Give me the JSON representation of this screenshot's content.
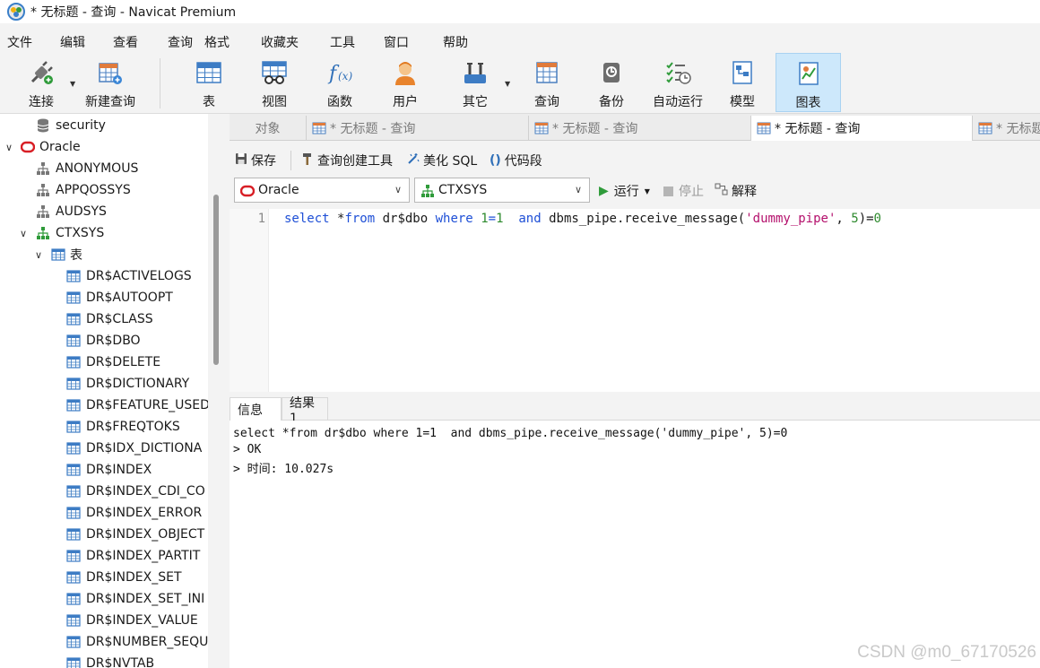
{
  "window": {
    "title": "* 无标题 - 查询 - Navicat Premium"
  },
  "menu": [
    "文件",
    "编辑",
    "查看",
    "查询",
    "格式",
    "收藏夹",
    "工具",
    "窗口",
    "帮助"
  ],
  "toolbar": {
    "connect": "连接",
    "new_query": "新建查询",
    "table": "表",
    "view": "视图",
    "function": "函数",
    "user": "用户",
    "other": "其它",
    "query": "查询",
    "backup": "备份",
    "auto_run": "自动运行",
    "model": "模型",
    "chart": "图表"
  },
  "sidebar": {
    "items": [
      {
        "label": "security",
        "icon": "database-icon"
      },
      {
        "label": "Oracle",
        "icon": "oracle-connection-icon"
      },
      {
        "label": "ANONYMOUS",
        "icon": "schema-icon"
      },
      {
        "label": "APPQOSSYS",
        "icon": "schema-icon"
      },
      {
        "label": "AUDSYS",
        "icon": "schema-icon"
      },
      {
        "label": "CTXSYS",
        "icon": "schema-icon"
      },
      {
        "label": "表",
        "icon": "table-icon"
      }
    ],
    "tables": [
      "DR$ACTIVELOGS",
      "DR$AUTOOPT",
      "DR$CLASS",
      "DR$DBO",
      "DR$DELETE",
      "DR$DICTIONARY",
      "DR$FEATURE_USED",
      "DR$FREQTOKS",
      "DR$IDX_DICTIONA",
      "DR$INDEX",
      "DR$INDEX_CDI_CO",
      "DR$INDEX_ERROR",
      "DR$INDEX_OBJECT",
      "DR$INDEX_PARTIT",
      "DR$INDEX_SET",
      "DR$INDEX_SET_INI",
      "DR$INDEX_VALUE",
      "DR$NUMBER_SEQU",
      "DR$NVTAB"
    ]
  },
  "tabs": [
    "对象",
    "* 无标题 - 查询",
    "* 无标题 - 查询",
    "* 无标题 - 查询",
    "* 无标题"
  ],
  "query_toolbar": {
    "save": "保存",
    "query_builder": "查询创建工具",
    "beautify": "美化 SQL",
    "code_snippet": "代码段"
  },
  "selectors": {
    "connection": "Oracle",
    "schema": "CTXSYS",
    "run": "运行",
    "stop": "停止",
    "explain": "解释"
  },
  "editor": {
    "line_number": "1",
    "tokens": {
      "t1": "select",
      "t2": " *",
      "t3": "from",
      "t4": " dr$dbo ",
      "t5": "where",
      "t6": " ",
      "t7": "1",
      "t8": "=",
      "t9": "1",
      "t10": "  ",
      "t11": "and",
      "t12": " dbms_pipe.receive_message(",
      "t13": "'dummy_pipe'",
      "t14": ", ",
      "t15": "5",
      "t16": ")=",
      "t17": "0"
    }
  },
  "result_tabs": [
    "信息",
    "结果 1"
  ],
  "results": [
    "select *from dr$dbo where 1=1  and dbms_pipe.receive_message('dummy_pipe', 5)=0",
    "> OK",
    "> 时间: 10.027s"
  ],
  "watermark": "CSDN @m0_67170526",
  "colors": {
    "keyword": "#1e4fd6",
    "string": "#b4106c",
    "number": "#2e8a2e",
    "active_tool": "#cde8fb"
  }
}
